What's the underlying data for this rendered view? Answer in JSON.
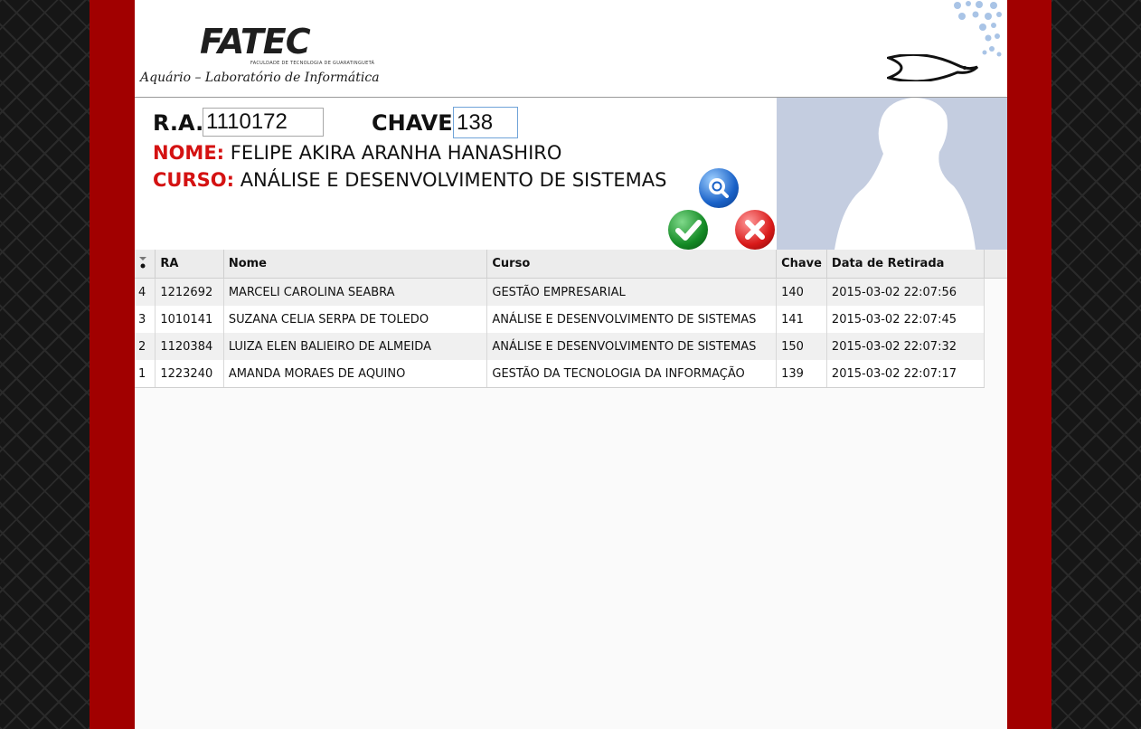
{
  "header": {
    "logo_text": "FATEC",
    "logo_subtitle": "FACULDADE DE TECNOLOGIA DE GUARATINGUETÁ",
    "tagline": "Aquário – Laboratório de Informática"
  },
  "form": {
    "ra_label": "R.A.:",
    "ra_value": "1110172",
    "chave_label": "CHAVE:",
    "chave_value": "138",
    "nome_label": "NOME:",
    "nome_value": " FELIPE AKIRA ARANHA HANASHIRO",
    "curso_label": "CURSO:",
    "curso_value": " ANÁLISE E DESENVOLVIMENTO DE SISTEMAS"
  },
  "buttons": {
    "search_icon": "magnifier-icon",
    "confirm_icon": "checkmark-icon",
    "cancel_icon": "x-icon"
  },
  "table": {
    "columns": [
      "RA",
      "Nome",
      "Curso",
      "Chave",
      "Data de Retirada"
    ],
    "rows": [
      {
        "idx": "4",
        "ra": "1212692",
        "nome": "MARCELI CAROLINA SEABRA",
        "curso": "GESTÃO EMPRESARIAL",
        "chave": "140",
        "data": "2015-03-02 22:07:56"
      },
      {
        "idx": "3",
        "ra": "1010141",
        "nome": "SUZANA CELIA SERPA DE TOLEDO",
        "curso": "ANÁLISE E DESENVOLVIMENTO DE SISTEMAS",
        "chave": "141",
        "data": "2015-03-02 22:07:45"
      },
      {
        "idx": "2",
        "ra": "1120384",
        "nome": "LUIZA ELEN BALIEIRO DE ALMEIDA",
        "curso": "ANÁLISE E DESENVOLVIMENTO DE SISTEMAS",
        "chave": "150",
        "data": "2015-03-02 22:07:32"
      },
      {
        "idx": "1",
        "ra": "1223240",
        "nome": "AMANDA MORAES DE AQUINO",
        "curso": "GESTÃO DA TECNOLOGIA DA INFORMAÇÃO",
        "chave": "139",
        "data": "2015-03-02 22:07:17"
      }
    ]
  },
  "colors": {
    "accent_red": "#a10000",
    "label_red": "#d41212",
    "photo_bg": "#c4cde0"
  }
}
